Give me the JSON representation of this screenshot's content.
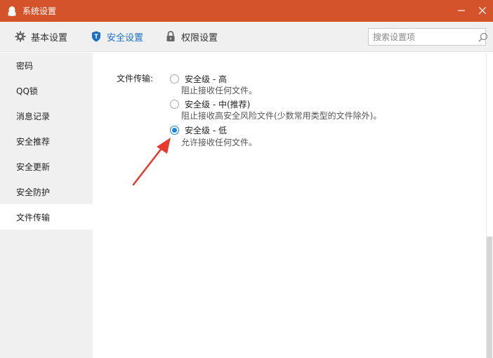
{
  "window": {
    "title": "系统设置",
    "accent_color": "#d4532a"
  },
  "toolbar": {
    "tabs": [
      {
        "label": "基本设置",
        "icon": "gear-icon"
      },
      {
        "label": "安全设置",
        "icon": "shield-icon",
        "active": true,
        "color": "#1a6fc4"
      },
      {
        "label": "权限设置",
        "icon": "lock-icon"
      }
    ],
    "search": {
      "placeholder": "搜索设置项",
      "icon": "search-icon"
    }
  },
  "sidebar": {
    "items": [
      {
        "label": "密码"
      },
      {
        "label": "QQ锁"
      },
      {
        "label": "消息记录"
      },
      {
        "label": "安全推荐"
      },
      {
        "label": "安全更新"
      },
      {
        "label": "安全防护"
      },
      {
        "label": "文件传输",
        "active": true
      }
    ]
  },
  "main": {
    "field_label": "文件传输:",
    "options": [
      {
        "label": "安全级 - 高",
        "desc": "阻止接收任何文件。",
        "checked": false
      },
      {
        "label": "安全级 - 中(推荐)",
        "desc": "阻止接收高安全风险文件(少数常用类型的文件除外)。",
        "checked": false
      },
      {
        "label": "安全级 - 低",
        "desc": "允许接收任何文件。",
        "checked": true
      }
    ],
    "annotation": {
      "type": "red-arrow",
      "color": "#e8392e"
    }
  }
}
